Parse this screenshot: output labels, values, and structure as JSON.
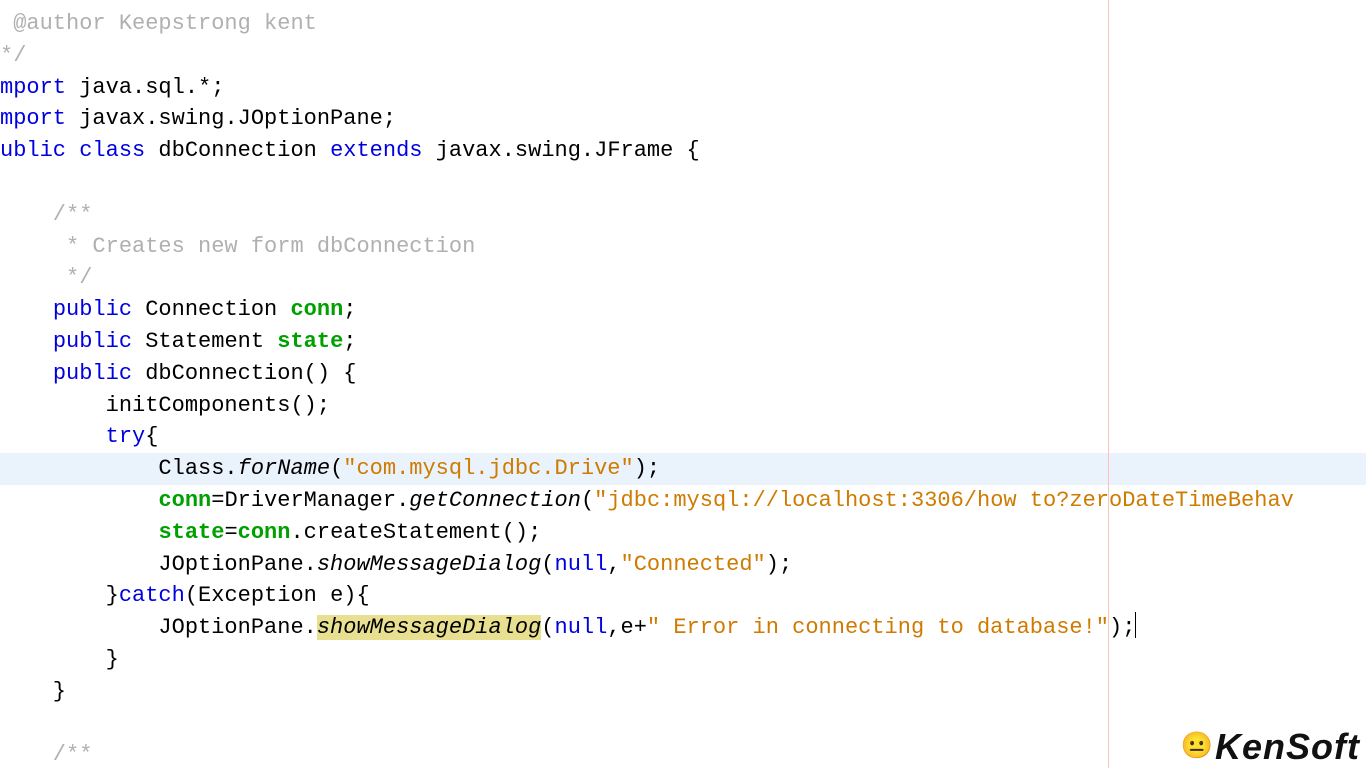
{
  "code": {
    "l1_author": " @author Keepstrong kent",
    "l2_cend": "*/",
    "l3_a": "mport",
    "l3_b": " java.sql.*;",
    "l4_a": "mport",
    "l4_b": " javax.swing.JOptionPane;",
    "l5_a": "ublic",
    "l5_b": " ",
    "l5_c": "class",
    "l5_d": " dbConnection ",
    "l5_e": "extends",
    "l5_f": " javax.swing.JFrame {",
    "l7_c1": "    /**",
    "l8_c2": "     * Creates new form dbConnection",
    "l9_c3": "     */",
    "l10_a": "    ",
    "l10_b": "public",
    "l10_c": " Connection ",
    "l10_d": "conn",
    "l10_e": ";",
    "l11_a": "    ",
    "l11_b": "public",
    "l11_c": " Statement ",
    "l11_d": "state",
    "l11_e": ";",
    "l12_a": "    ",
    "l12_b": "public",
    "l12_c": " dbConnection() {",
    "l13": "        initComponents();",
    "l14_a": "        ",
    "l14_b": "try",
    "l14_c": "{",
    "l15_a": "            Class.",
    "l15_b": "forName",
    "l15_c": "(",
    "l15_d": "\"com.mysql.jdbc.Drive\"",
    "l15_e": ");",
    "l16_a": "            ",
    "l16_b": "conn",
    "l16_c": "=DriverManager.",
    "l16_d": "getConnection",
    "l16_e": "(",
    "l16_f": "\"jdbc:mysql://localhost:3306/how to?zeroDateTimeBehav",
    "l17_a": "            ",
    "l17_b": "state",
    "l17_c": "=",
    "l17_d": "conn",
    "l17_e": ".createStatement();",
    "l18_a": "            JOptionPane.",
    "l18_b": "showMessageDialog",
    "l18_c": "(",
    "l18_d": "null",
    "l18_e": ",",
    "l18_f": "\"Connected\"",
    "l18_g": ");",
    "l19_a": "        }",
    "l19_b": "catch",
    "l19_c": "(Exception e){",
    "l20_a": "            JOptionPane.",
    "l20_b": "showMessageDialog",
    "l20_c": "(",
    "l20_d": "null",
    "l20_e": ",e+",
    "l20_f": "\" Error in connecting to database!\"",
    "l20_g": ");",
    "l21": "        }",
    "l22": "    }",
    "l24": "    /**"
  },
  "watermark": {
    "brand": "KenSoft",
    "icon": "😐"
  }
}
